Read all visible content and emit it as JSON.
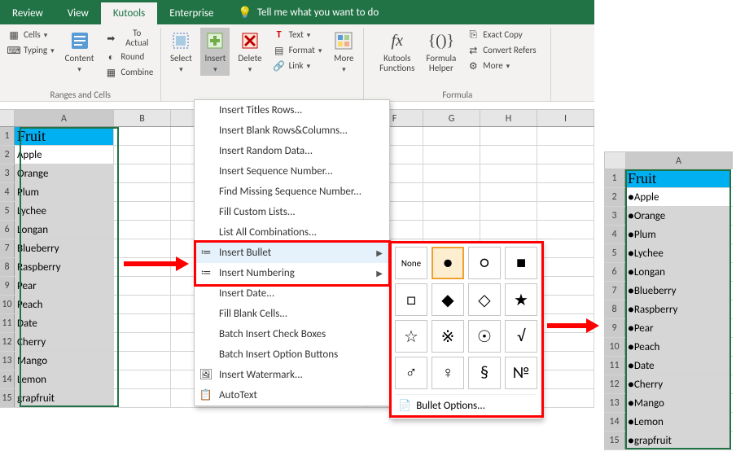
{
  "ribbon": {
    "tabs": [
      "Review",
      "View",
      "Kutools",
      "Enterprise"
    ],
    "tell": "Tell me what you want to do",
    "groups": {
      "ranges_cells": "Ranges and Cells",
      "formula": "Formula"
    },
    "btns": {
      "cells": "Cells",
      "typing": "Typing",
      "content": "Content",
      "to_actual": "To Actual",
      "round": "Round",
      "combine": "Combine",
      "select": "Select",
      "insert": "Insert",
      "delete": "Delete",
      "text": "Text",
      "format": "Format",
      "link": "Link",
      "more": "More",
      "kfunc": "Kutools\nFunctions",
      "fhelper": "Formula\nHelper",
      "exact_copy": "Exact Copy",
      "convert_refers": "Convert Refers",
      "more2": "More"
    }
  },
  "menu": {
    "items": [
      "Insert Titles Rows...",
      "Insert Blank Rows&Columns...",
      "Insert Random Data...",
      "Insert Sequence Number...",
      "Find Missing Sequence Number...",
      "Fill Custom Lists...",
      "List All Combinations...",
      "Insert Bullet",
      "Insert Numbering",
      "Insert Date...",
      "Fill Blank Cells...",
      "Batch Insert Check Boxes",
      "Batch Insert Option Buttons",
      "Insert Watermark...",
      "AutoText"
    ],
    "bullet_options": "Bullet Options...",
    "bullet_none": "None"
  },
  "grid": {
    "cols_left": [
      "A",
      "B",
      "F",
      "G",
      "H",
      "I"
    ],
    "cols_right": [
      "A"
    ],
    "header": "Fruit",
    "rows": [
      "Apple",
      "Orange",
      "Plum",
      "Lychee",
      "Longan",
      "Blueberry",
      "Raspberry",
      "Pear",
      "Peach",
      "Date",
      "Cherry",
      "Mango",
      "Lemon",
      "grapfruit"
    ],
    "rows_after": [
      "●Apple",
      "●Orange",
      "●Plum",
      "●Lychee",
      "●Longan",
      "●Blueberry",
      "●Raspberry",
      "●Pear",
      "●Peach",
      "●Date",
      "●Cherry",
      "●Mango",
      "●Lemon",
      "●grapfruit"
    ]
  },
  "bullets": [
    "●",
    "○",
    "■",
    "□",
    "◆",
    "◇",
    "★",
    "☆",
    "※",
    "☉",
    "√",
    "♂",
    "♀",
    "§",
    "№"
  ]
}
